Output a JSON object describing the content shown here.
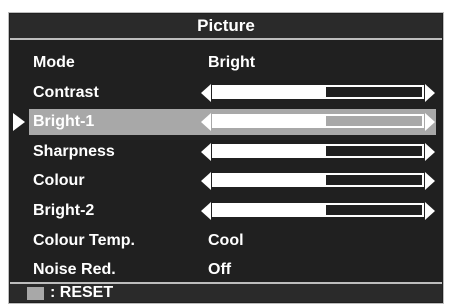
{
  "menu": {
    "title": "Picture",
    "items": [
      {
        "label": "Mode",
        "type": "value",
        "value": "Bright",
        "selected": false
      },
      {
        "label": "Contrast",
        "type": "slider",
        "level_percent": 54,
        "selected": false
      },
      {
        "label": "Bright-1",
        "type": "slider",
        "level_percent": 54,
        "selected": true
      },
      {
        "label": "Sharpness",
        "type": "slider",
        "level_percent": 54,
        "selected": false
      },
      {
        "label": "Colour",
        "type": "slider",
        "level_percent": 54,
        "selected": false
      },
      {
        "label": "Bright-2",
        "type": "slider",
        "level_percent": 54,
        "selected": false
      },
      {
        "label": "Colour Temp.",
        "type": "value",
        "value": "Cool",
        "selected": false
      },
      {
        "label": "Noise Red.",
        "type": "value",
        "value": "Off",
        "selected": false
      }
    ]
  },
  "footer": {
    "reset_label": ": RESET",
    "swatch_color": "#a8a8a8"
  },
  "colors": {
    "background": "#202020",
    "text": "#ffffff",
    "highlight": "#a8a8a8",
    "border": "#bdbdbd"
  },
  "icons": {
    "cursor": "triangle-right-icon",
    "slider_left": "triangle-left-icon",
    "slider_right": "triangle-right-icon"
  }
}
